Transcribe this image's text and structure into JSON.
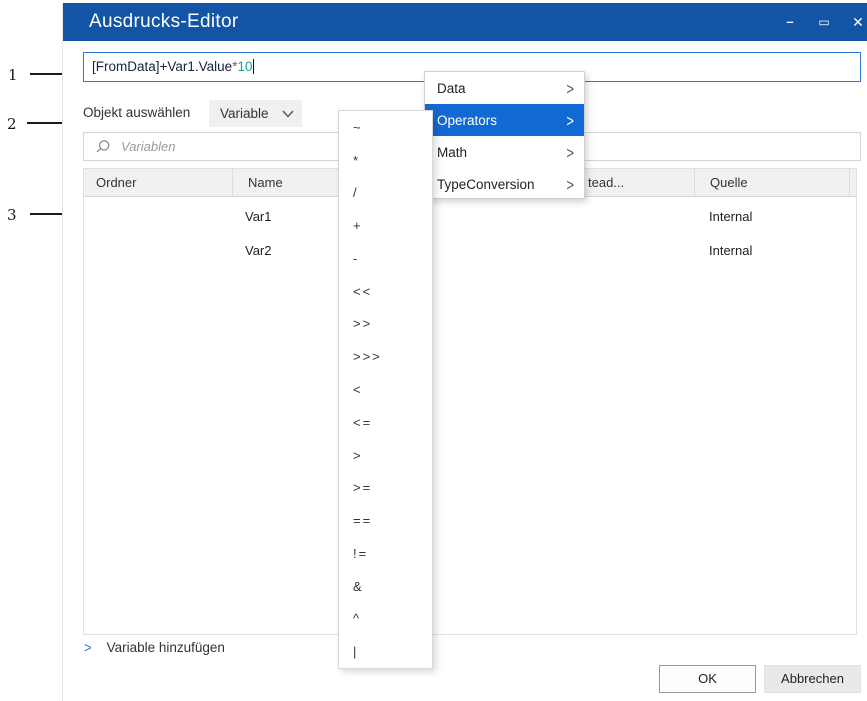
{
  "window": {
    "title": "Ausdrucks-Editor"
  },
  "icons": {
    "minimize": "–",
    "maximize": "▭",
    "close": "✕",
    "submenu_arrow": ">",
    "link_chevron": ">"
  },
  "expression": {
    "text_main": "[FromData]+Var1.Value",
    "operator": "*",
    "number": "10"
  },
  "object_select": {
    "label": "Objekt auswählen",
    "value": "Variable"
  },
  "search": {
    "placeholder": "Variablen"
  },
  "table": {
    "columns": [
      "Ordner",
      "Name",
      "tead...",
      "Quelle"
    ],
    "rows": [
      {
        "ordner": "",
        "name": "Var1",
        "quelle": "Internal"
      },
      {
        "ordner": "",
        "name": "Var2",
        "quelle": "Internal"
      }
    ]
  },
  "add_variable_link": "Variable hinzufügen",
  "buttons": {
    "ok": "OK",
    "cancel": "Abbrechen"
  },
  "context_menu": {
    "items": [
      {
        "label": "Data"
      },
      {
        "label": "Operators"
      },
      {
        "label": "Math"
      },
      {
        "label": "TypeConversion"
      }
    ]
  },
  "operators_submenu": [
    "~",
    "*",
    "/",
    "+",
    "-",
    "<<",
    ">>",
    ">>>",
    "<",
    "<=",
    ">",
    ">=",
    "==",
    "!=",
    "&",
    "^",
    "|"
  ],
  "annotations": [
    {
      "number": "1"
    },
    {
      "number": "2"
    },
    {
      "number": "3"
    }
  ],
  "colors": {
    "titlebar_blue": "#1254a5",
    "menu_highlight_blue": "#1269d3",
    "expression_border_blue": "#2e7bd2",
    "number_teal": "#17a398",
    "link_blue": "#2b7cd3"
  }
}
